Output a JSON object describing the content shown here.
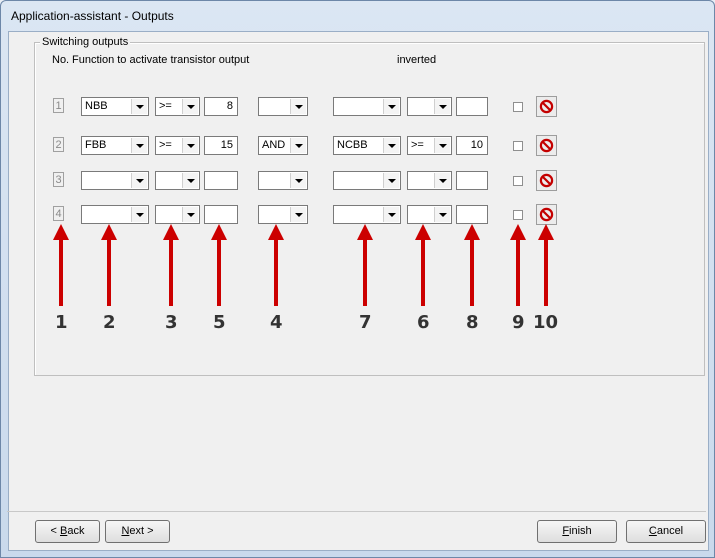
{
  "window": {
    "title": "Application-assistant - Outputs"
  },
  "group": {
    "legend": "Switching outputs"
  },
  "headers": {
    "no": "No.",
    "function": "Function to activate transistor output",
    "inverted": "inverted"
  },
  "rows": [
    {
      "no": "1",
      "func1": "NBB",
      "op1": ">=",
      "val1": "8",
      "logic": "",
      "func2": "",
      "op2": "",
      "val2": ""
    },
    {
      "no": "2",
      "func1": "FBB",
      "op1": ">=",
      "val1": "15",
      "logic": "AND",
      "func2": "NCBB",
      "op2": ">=",
      "val2": "10"
    },
    {
      "no": "3",
      "func1": "",
      "op1": "",
      "val1": "",
      "logic": "",
      "func2": "",
      "op2": "",
      "val2": ""
    },
    {
      "no": "4",
      "func1": "",
      "op1": "",
      "val1": "",
      "logic": "",
      "func2": "",
      "op2": "",
      "val2": ""
    }
  ],
  "annotations": {
    "color": "#cc0000",
    "labels": [
      "1",
      "2",
      "3",
      "5",
      "4",
      "7",
      "6",
      "8",
      "9",
      "10"
    ]
  },
  "buttons": {
    "back": {
      "pre": "< ",
      "accel": "B",
      "post": "ack"
    },
    "next": {
      "pre": "",
      "accel": "N",
      "post": "ext >"
    },
    "finish": {
      "pre": "",
      "accel": "F",
      "post": "inish"
    },
    "cancel": {
      "pre": "",
      "accel": "C",
      "post": "ancel"
    }
  },
  "icons": {
    "delete": "prohibit-icon",
    "dropdown": "chevron-down-icon"
  }
}
